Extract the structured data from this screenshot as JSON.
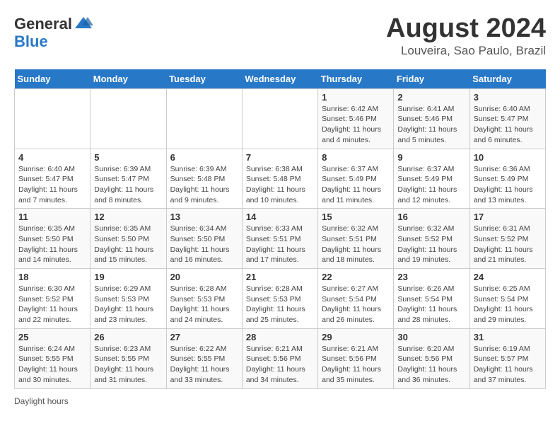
{
  "logo": {
    "general": "General",
    "blue": "Blue"
  },
  "title": "August 2024",
  "subtitle": "Louveira, Sao Paulo, Brazil",
  "days_of_week": [
    "Sunday",
    "Monday",
    "Tuesday",
    "Wednesday",
    "Thursday",
    "Friday",
    "Saturday"
  ],
  "footer": "Daylight hours",
  "weeks": [
    [
      {
        "day": "",
        "info": ""
      },
      {
        "day": "",
        "info": ""
      },
      {
        "day": "",
        "info": ""
      },
      {
        "day": "",
        "info": ""
      },
      {
        "day": "1",
        "info": "Sunrise: 6:42 AM\nSunset: 5:46 PM\nDaylight: 11 hours and 4 minutes."
      },
      {
        "day": "2",
        "info": "Sunrise: 6:41 AM\nSunset: 5:46 PM\nDaylight: 11 hours and 5 minutes."
      },
      {
        "day": "3",
        "info": "Sunrise: 6:40 AM\nSunset: 5:47 PM\nDaylight: 11 hours and 6 minutes."
      }
    ],
    [
      {
        "day": "4",
        "info": "Sunrise: 6:40 AM\nSunset: 5:47 PM\nDaylight: 11 hours and 7 minutes."
      },
      {
        "day": "5",
        "info": "Sunrise: 6:39 AM\nSunset: 5:47 PM\nDaylight: 11 hours and 8 minutes."
      },
      {
        "day": "6",
        "info": "Sunrise: 6:39 AM\nSunset: 5:48 PM\nDaylight: 11 hours and 9 minutes."
      },
      {
        "day": "7",
        "info": "Sunrise: 6:38 AM\nSunset: 5:48 PM\nDaylight: 11 hours and 10 minutes."
      },
      {
        "day": "8",
        "info": "Sunrise: 6:37 AM\nSunset: 5:49 PM\nDaylight: 11 hours and 11 minutes."
      },
      {
        "day": "9",
        "info": "Sunrise: 6:37 AM\nSunset: 5:49 PM\nDaylight: 11 hours and 12 minutes."
      },
      {
        "day": "10",
        "info": "Sunrise: 6:36 AM\nSunset: 5:49 PM\nDaylight: 11 hours and 13 minutes."
      }
    ],
    [
      {
        "day": "11",
        "info": "Sunrise: 6:35 AM\nSunset: 5:50 PM\nDaylight: 11 hours and 14 minutes."
      },
      {
        "day": "12",
        "info": "Sunrise: 6:35 AM\nSunset: 5:50 PM\nDaylight: 11 hours and 15 minutes."
      },
      {
        "day": "13",
        "info": "Sunrise: 6:34 AM\nSunset: 5:50 PM\nDaylight: 11 hours and 16 minutes."
      },
      {
        "day": "14",
        "info": "Sunrise: 6:33 AM\nSunset: 5:51 PM\nDaylight: 11 hours and 17 minutes."
      },
      {
        "day": "15",
        "info": "Sunrise: 6:32 AM\nSunset: 5:51 PM\nDaylight: 11 hours and 18 minutes."
      },
      {
        "day": "16",
        "info": "Sunrise: 6:32 AM\nSunset: 5:52 PM\nDaylight: 11 hours and 19 minutes."
      },
      {
        "day": "17",
        "info": "Sunrise: 6:31 AM\nSunset: 5:52 PM\nDaylight: 11 hours and 21 minutes."
      }
    ],
    [
      {
        "day": "18",
        "info": "Sunrise: 6:30 AM\nSunset: 5:52 PM\nDaylight: 11 hours and 22 minutes."
      },
      {
        "day": "19",
        "info": "Sunrise: 6:29 AM\nSunset: 5:53 PM\nDaylight: 11 hours and 23 minutes."
      },
      {
        "day": "20",
        "info": "Sunrise: 6:28 AM\nSunset: 5:53 PM\nDaylight: 11 hours and 24 minutes."
      },
      {
        "day": "21",
        "info": "Sunrise: 6:28 AM\nSunset: 5:53 PM\nDaylight: 11 hours and 25 minutes."
      },
      {
        "day": "22",
        "info": "Sunrise: 6:27 AM\nSunset: 5:54 PM\nDaylight: 11 hours and 26 minutes."
      },
      {
        "day": "23",
        "info": "Sunrise: 6:26 AM\nSunset: 5:54 PM\nDaylight: 11 hours and 28 minutes."
      },
      {
        "day": "24",
        "info": "Sunrise: 6:25 AM\nSunset: 5:54 PM\nDaylight: 11 hours and 29 minutes."
      }
    ],
    [
      {
        "day": "25",
        "info": "Sunrise: 6:24 AM\nSunset: 5:55 PM\nDaylight: 11 hours and 30 minutes."
      },
      {
        "day": "26",
        "info": "Sunrise: 6:23 AM\nSunset: 5:55 PM\nDaylight: 11 hours and 31 minutes."
      },
      {
        "day": "27",
        "info": "Sunrise: 6:22 AM\nSunset: 5:55 PM\nDaylight: 11 hours and 33 minutes."
      },
      {
        "day": "28",
        "info": "Sunrise: 6:21 AM\nSunset: 5:56 PM\nDaylight: 11 hours and 34 minutes."
      },
      {
        "day": "29",
        "info": "Sunrise: 6:21 AM\nSunset: 5:56 PM\nDaylight: 11 hours and 35 minutes."
      },
      {
        "day": "30",
        "info": "Sunrise: 6:20 AM\nSunset: 5:56 PM\nDaylight: 11 hours and 36 minutes."
      },
      {
        "day": "31",
        "info": "Sunrise: 6:19 AM\nSunset: 5:57 PM\nDaylight: 11 hours and 37 minutes."
      }
    ]
  ]
}
